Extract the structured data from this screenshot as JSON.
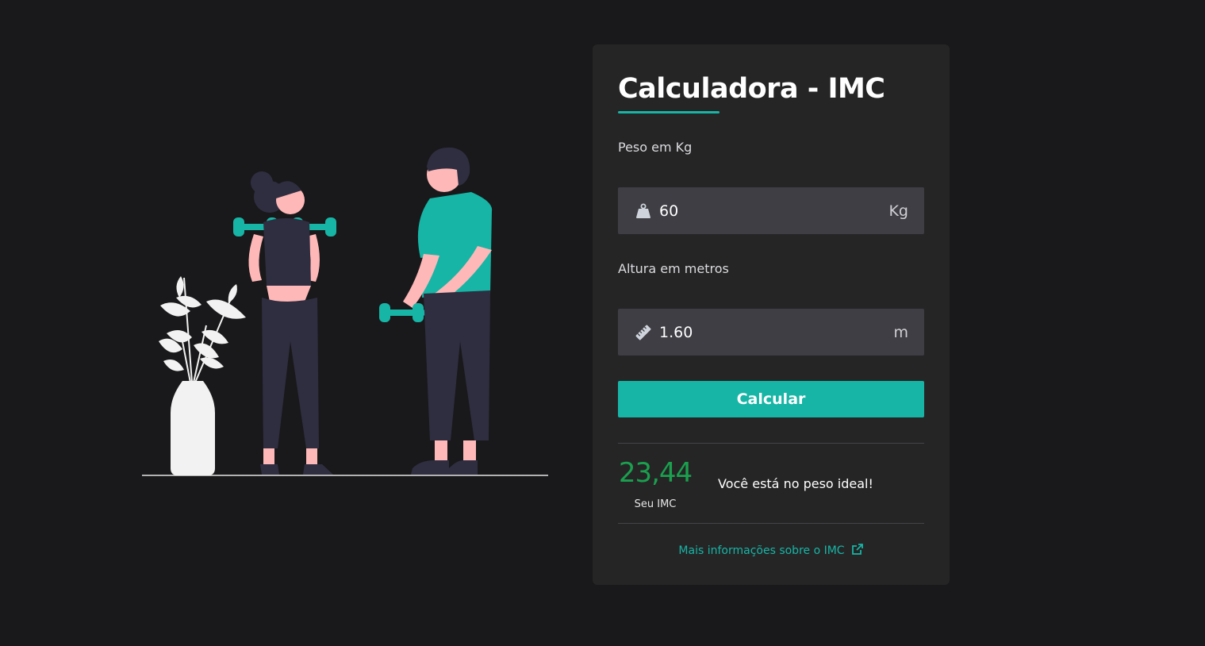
{
  "card": {
    "title": "Calculadora - IMC",
    "weight": {
      "label": "Peso em Kg",
      "value": "60",
      "unit": "Kg",
      "icon": "weight-icon"
    },
    "height": {
      "label": "Altura em metros",
      "value": "1.60",
      "unit": "m",
      "icon": "ruler-icon"
    },
    "button_label": "Calcular",
    "result": {
      "value": "23,44",
      "caption": "Seu IMC",
      "message": "Você está no peso ideal!"
    },
    "more_info_link": "Mais informações sobre o IMC",
    "more_info_icon": "external-link-icon"
  },
  "colors": {
    "background": "#19191b",
    "card": "#252526",
    "accent": "#17b5a5",
    "input": "#3e3e44",
    "result": "#1aa04e"
  }
}
